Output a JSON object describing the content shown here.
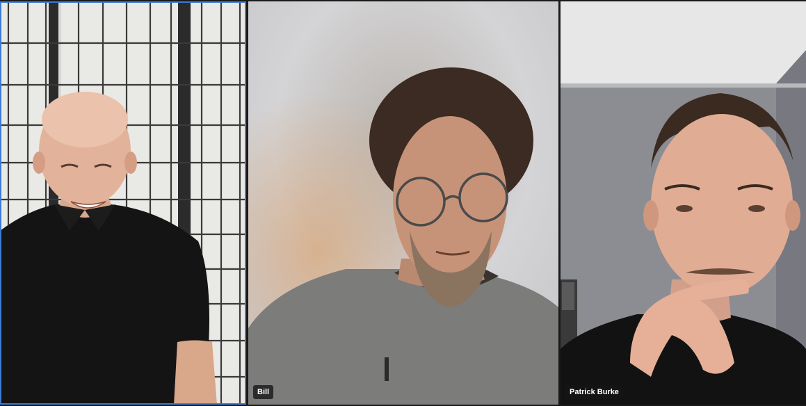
{
  "participants": [
    {
      "name": "",
      "active_speaker": true
    },
    {
      "name": "Bill",
      "active_speaker": false
    },
    {
      "name": "Patrick Burke",
      "active_speaker": false
    }
  ],
  "colors": {
    "active_speaker_border": "#3a7bd5",
    "name_tag_background": "#141414",
    "name_tag_text": "#ffffff"
  }
}
